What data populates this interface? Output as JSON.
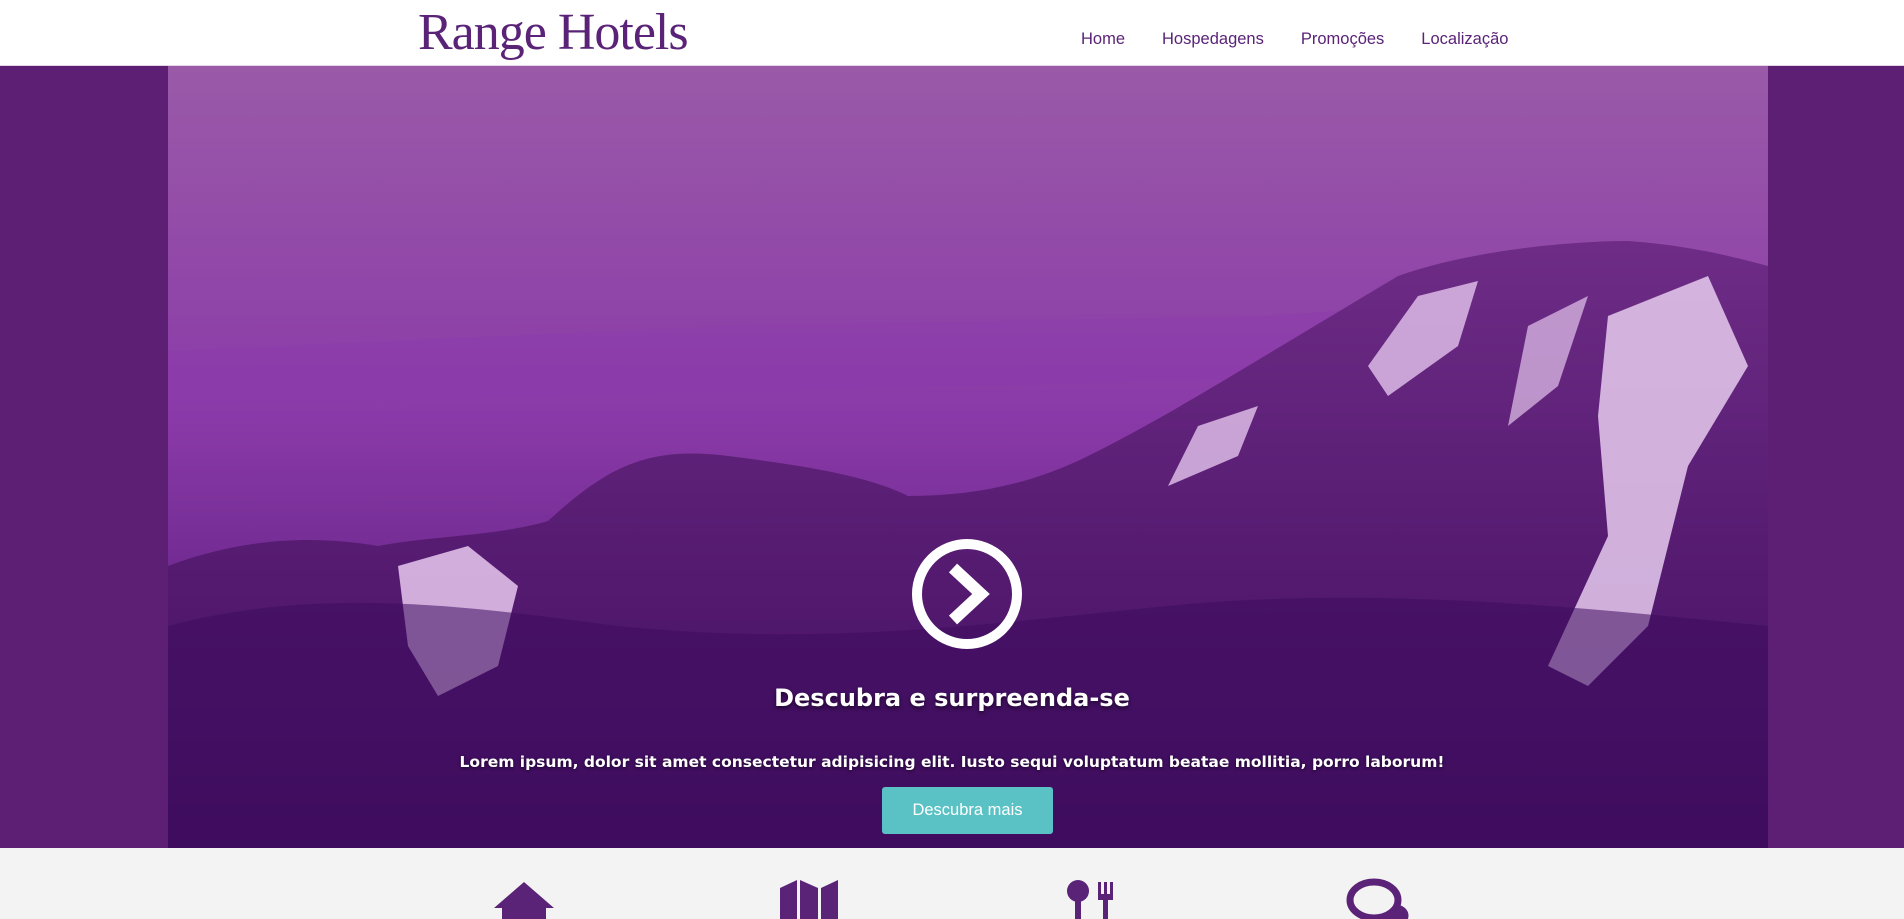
{
  "brand": {
    "logo_text": "Range Hotels"
  },
  "nav": {
    "items": [
      {
        "label": "Home"
      },
      {
        "label": "Hospedagens"
      },
      {
        "label": "Promoções"
      },
      {
        "label": "Localização"
      }
    ]
  },
  "hero": {
    "play_icon": "chevron-circle-right-icon",
    "headline": "Descubra e surpreenda-se",
    "subtext": "Lorem ipsum, dolor sit amet consectetur adipisicing elit. Iusto sequi voluptatum beatae mollitia, porro laborum!",
    "cta_label": "Descubra mais"
  },
  "features": {
    "icons": [
      "home-icon",
      "map-icon",
      "restaurant-icon",
      "chat-icon"
    ]
  },
  "colors": {
    "brand_purple": "#5a2377",
    "hero_side": "#5c1f73",
    "cta_teal": "#5ac2c4",
    "feature_bg": "#f4f3f4"
  }
}
